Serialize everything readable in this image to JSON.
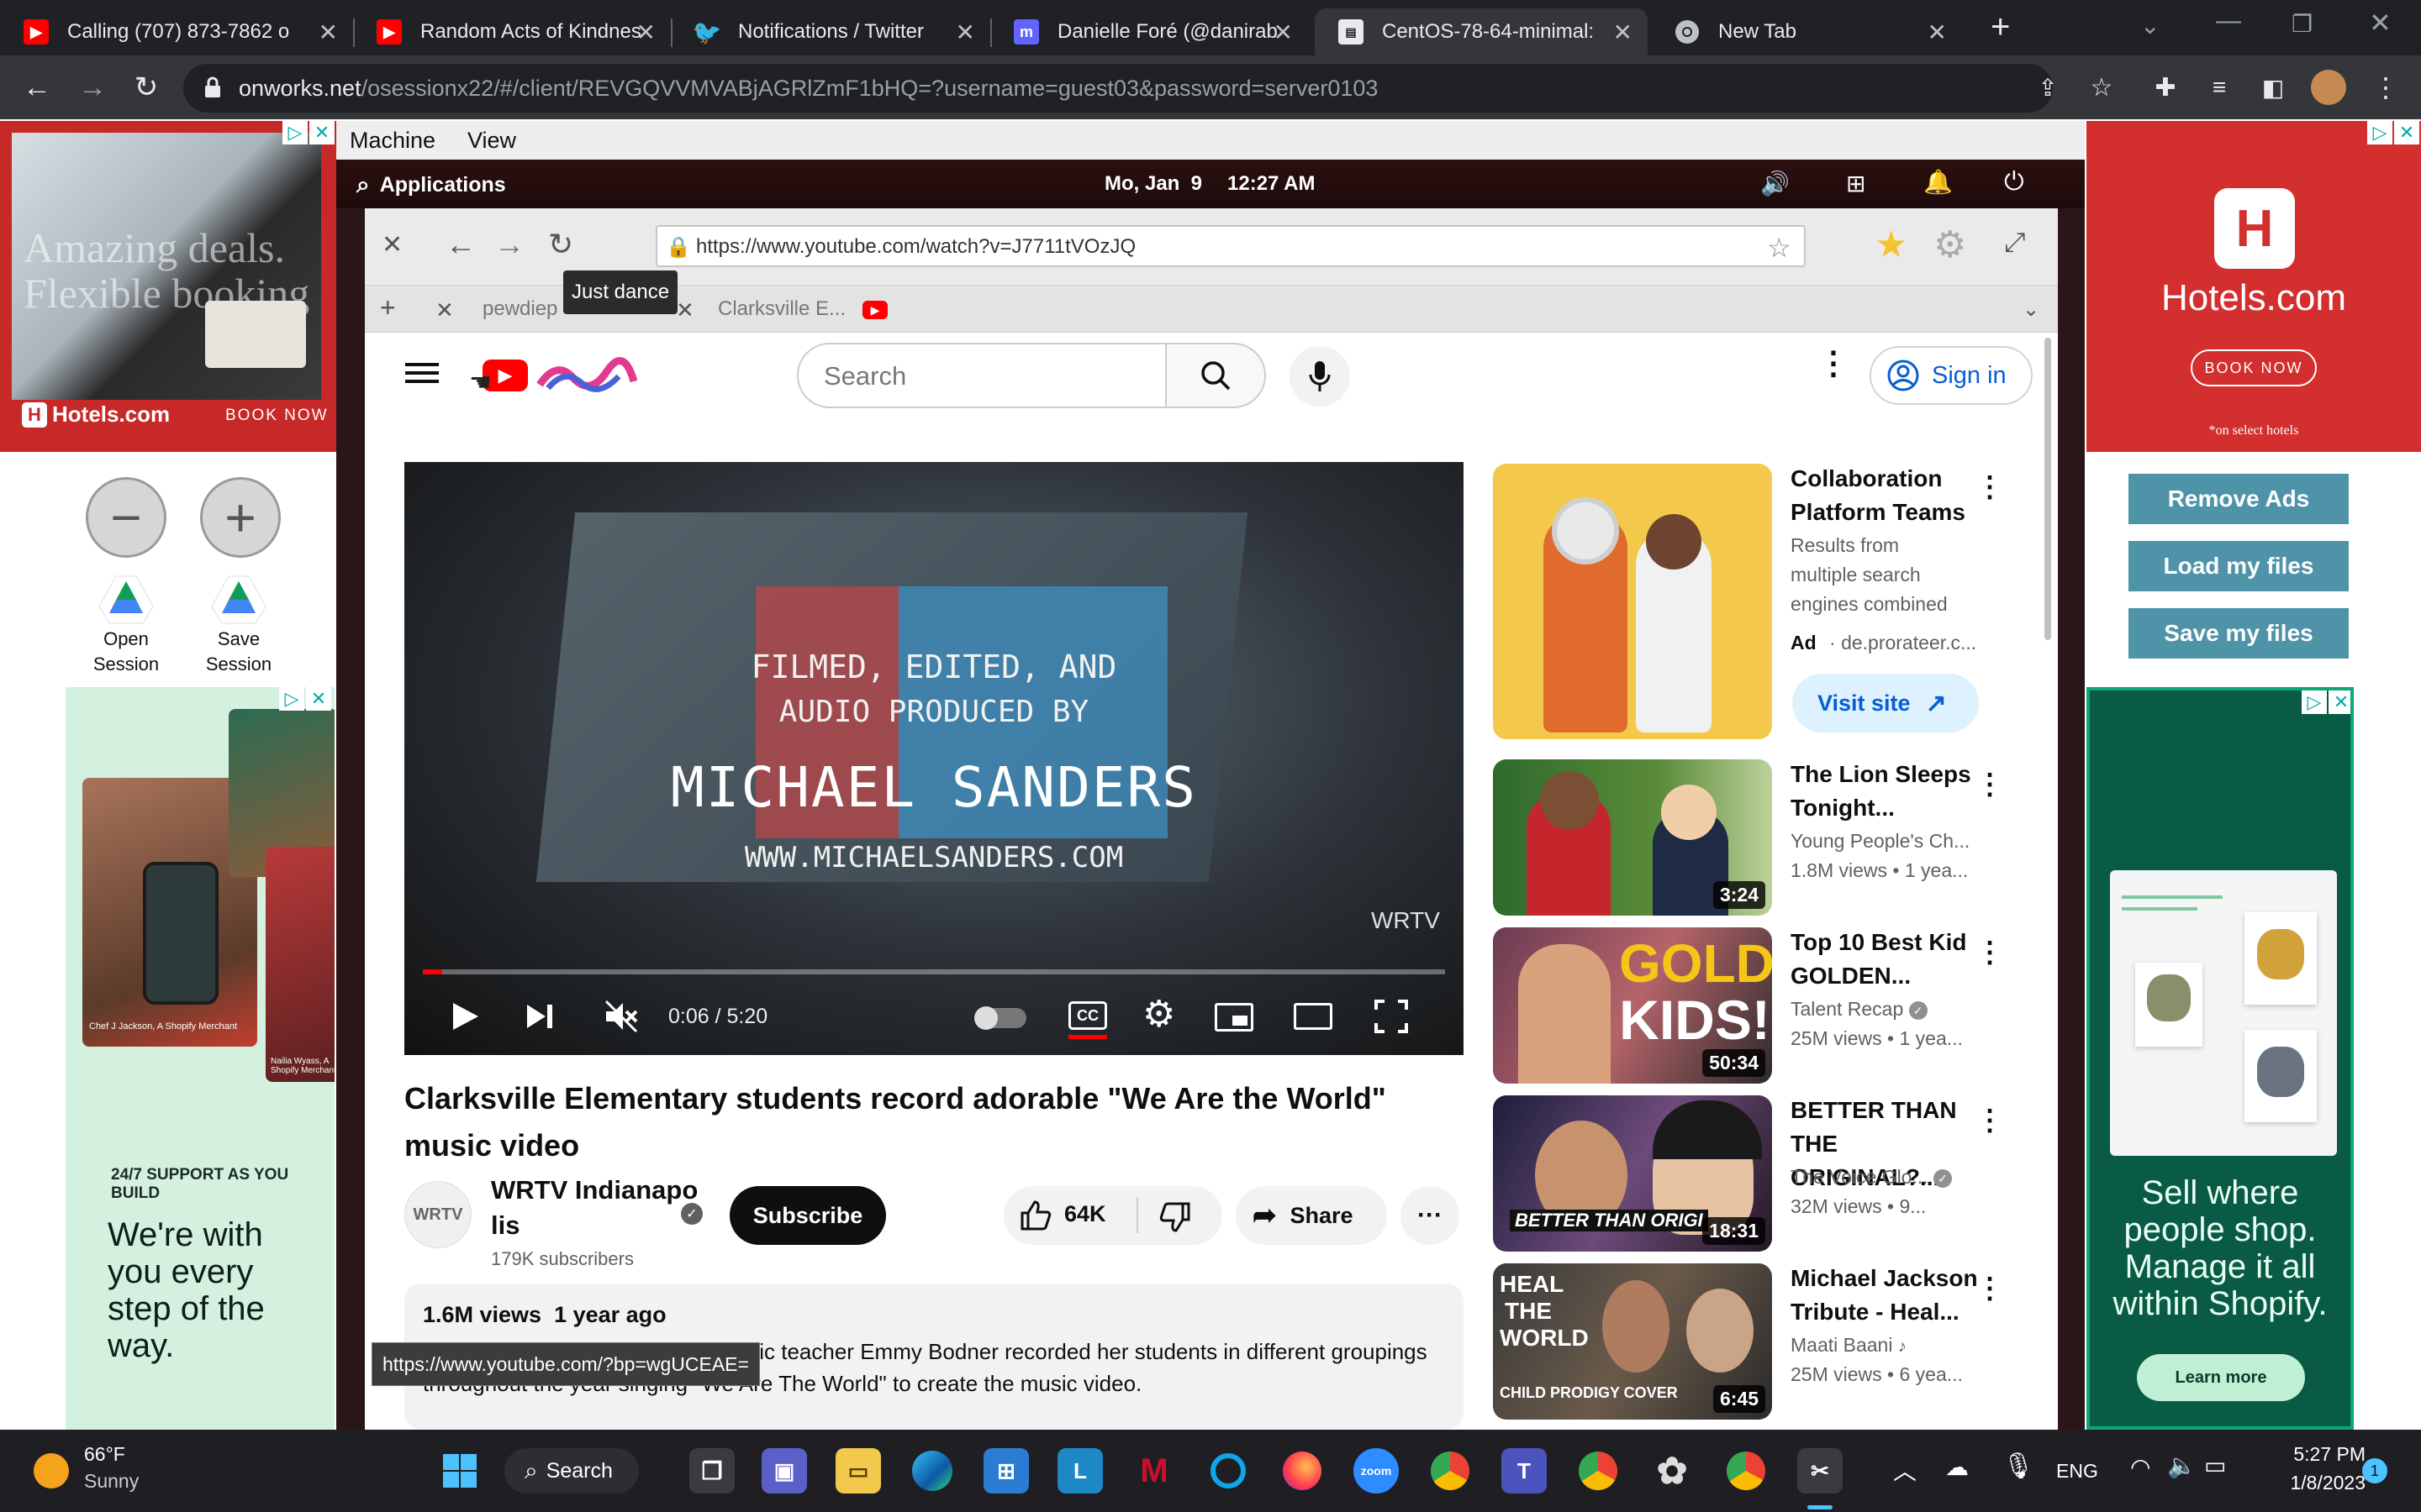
{
  "tabs": [
    {
      "title": "Calling (707) 873-7862 o",
      "icon": "youtube-icon"
    },
    {
      "title": "Random Acts of Kindnes",
      "icon": "youtube-icon"
    },
    {
      "title": "Notifications / Twitter",
      "icon": "twitter-icon"
    },
    {
      "title": "Danielle Foré (@danirab",
      "icon": "mastodon-icon"
    },
    {
      "title": "CentOS-78-64-minimal:",
      "icon": "onworks-icon"
    },
    {
      "title": "New Tab",
      "icon": "chrome-icon"
    }
  ],
  "omnibox": {
    "url_host": "onworks.net",
    "url_path": "/osessionx22/#/client/REVGQVVMVABjAGRlZmF1bHQ=?username=guest03&password=server0103"
  },
  "ads": {
    "hotels_left": {
      "tagline": "Amazing deals. Flexible booking",
      "brand": "Hotels.com",
      "cta": "BOOK NOW"
    },
    "hotels_right": {
      "brand": "Hotels.com",
      "cta": "BOOK NOW",
      "note": "*on select hotels"
    },
    "shopify_left": {
      "support": "24/7 SUPPORT AS YOU BUILD",
      "headline": "We're with you every step of the way.",
      "person1": "Chef J Jackson, A Shopify Merchant",
      "person2": "Nailia Wyass, A Shopify Merchant"
    },
    "shopify_right": {
      "headline": "Sell where people shop. Manage it all within Shopify.",
      "cta": "Learn more"
    }
  },
  "session": {
    "open_label": "Open Session",
    "save_label": "Save Session"
  },
  "side_buttons": {
    "remove_ads": "Remove Ads",
    "load_files": "Load my files",
    "save_files": "Save my files"
  },
  "vm": {
    "menu": [
      "Machine",
      "View"
    ],
    "gnome": {
      "applications": "Applications",
      "date": "Mo, Jan  9",
      "time": "12:27 AM"
    },
    "browser": {
      "url": "https://www.youtube.com/watch?v=J7711tVOzJQ",
      "tabs": [
        {
          "title": "pewdiep"
        },
        {
          "title": "Clarksville E..."
        }
      ],
      "tooltip": "Just dance"
    }
  },
  "youtube": {
    "search_placeholder": "Search",
    "sign_in": "Sign in",
    "video": {
      "overlay_line1": "FILMED, EDITED, AND",
      "overlay_line2": "AUDIO PRODUCED BY",
      "overlay_name": "MICHAEL SANDERS",
      "overlay_site": "WWW.MICHAELSANDERS.COM",
      "watermark": "WRTV",
      "time": "0:06 / 5:20",
      "progress_fraction": 0.019
    },
    "title": "Clarksville Elementary students record adorable \"We Are the World\" music video",
    "channel": {
      "avatar": "WRTV",
      "name": "WRTV Indianapolis",
      "subscribers": "179K subscribers",
      "subscribe": "Subscribe"
    },
    "likes": "64K",
    "share": "Share",
    "description": {
      "stats": "1.6M views  1 year ago",
      "text": "Clarksville Elementary School music teacher Emmy Bodner recorded her students in different groupings throughout the year singing \"We Are The World\" to create the music video."
    },
    "status_url": "https://www.youtube.com/?bp=wgUCEAE=",
    "recommendations": [
      {
        "title": "Collaboration Platform Teams",
        "line1": "Results from",
        "line2": "multiple search",
        "line3": "engines combined",
        "ad": "Ad",
        "domain": "de.prorateer.c...",
        "cta": "Visit site"
      },
      {
        "title": "The Lion Sleeps Tonight...",
        "channel": "Young People's Ch...",
        "meta": "1.8M views  • 1 yea...",
        "duration": "3:24"
      },
      {
        "title": "Top 10 Best Kid GOLDEN...",
        "channel": "Talent Recap",
        "meta": "25M views  • 1 yea...",
        "duration": "50:34",
        "thumb_text1": "GOLDEN",
        "thumb_text2": "KIDS!"
      },
      {
        "title": "BETTER THAN THE ORIGINAL?...",
        "channel": "The Voice Glo...",
        "meta": "32M views  • 9...",
        "duration": "18:31",
        "thumb_text": "BETTER THAN ORIGI"
      },
      {
        "title": "Michael Jackson Tribute - Heal...",
        "channel": "Maati Baani",
        "meta": "25M views  • 6 yea...",
        "duration": "6:45",
        "thumb_text1": "HEAL",
        "thumb_text2": "THE",
        "thumb_text3": "WORLD",
        "thumb_text4": "CHILD PRODIGY COVER"
      }
    ]
  },
  "taskbar": {
    "weather_temp": "66°F",
    "weather_desc": "Sunny",
    "search": "Search",
    "lang": "ENG",
    "time": "5:27 PM",
    "date": "1/8/2023",
    "notifications": "1"
  }
}
